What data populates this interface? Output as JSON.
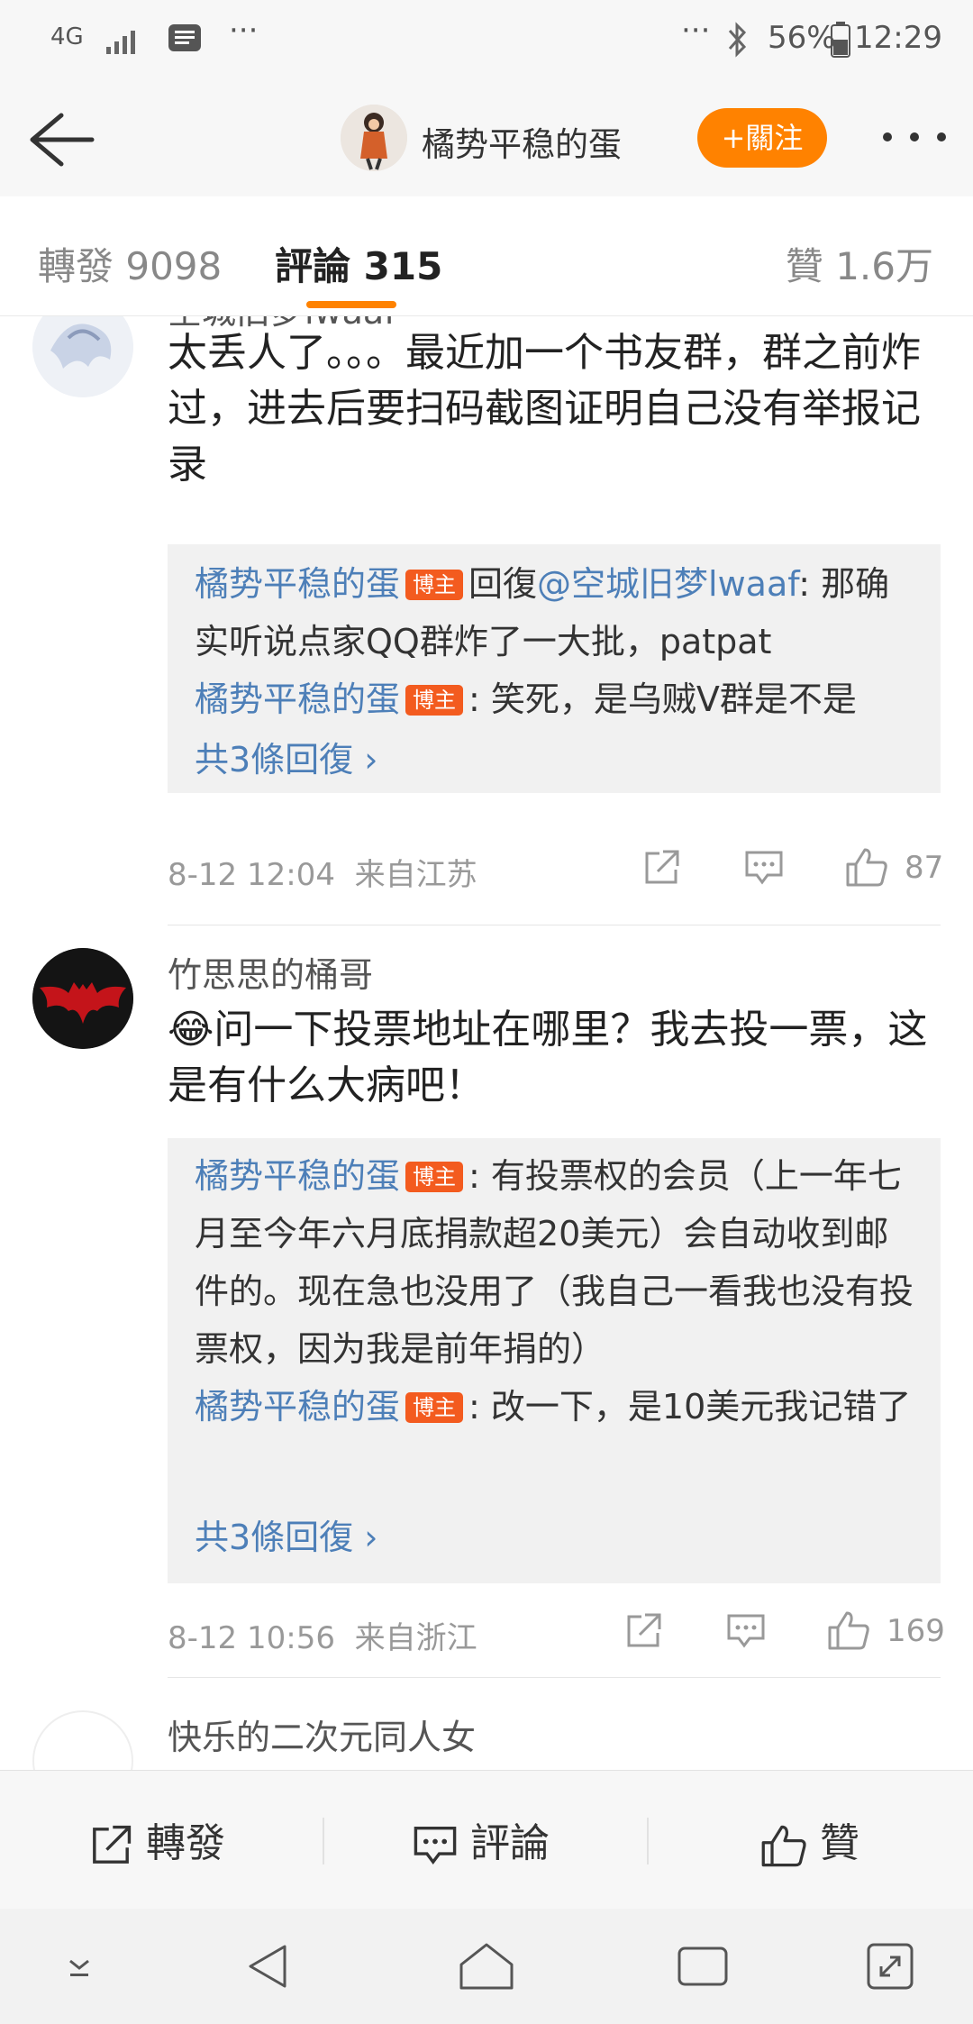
{
  "status_bar": {
    "network": "4G",
    "dots_left": "···",
    "dots_right": "···",
    "battery": "56%",
    "time": "12:29"
  },
  "header": {
    "title": "橘势平稳的蛋",
    "follow_label": "+關注"
  },
  "tabs": {
    "repost": "轉發 9098",
    "comments": "評論 315",
    "likes": "贊 1.6万"
  },
  "comments": [
    {
      "user": "空城旧梦lwaaf",
      "text": "太丢人了。。。最近加一个书友群，群之前炸过，进去后要扫码截图证明自己没有举报记录",
      "replies": [
        {
          "name": "橘势平稳的蛋",
          "badge": "博主",
          "prefix": "回復",
          "mention": "@空城旧梦lwaaf",
          "text": ": 那确实听说点家QQ群炸了一大批，patpat"
        },
        {
          "name": "橘势平稳的蛋",
          "badge": "博主",
          "text": ":  笑死，是乌贼V群是不是"
        }
      ],
      "more_replies": "共3條回復 ›",
      "time": "8-12 12:04",
      "location": "来自江苏",
      "likes": "87"
    },
    {
      "user": "竹思思的桶哥",
      "emoji": "😂",
      "text": "问一下投票地址在哪里？我去投一票，这是有什么大病吧！",
      "replies": [
        {
          "name": "橘势平稳的蛋",
          "badge": "博主",
          "text": ": 有投票权的会员（上一年七月至今年六月底捐款超20美元）会自动收到邮件的。现在急也没用了（我自己一看我也没有投票权，因为我是前年捐的）"
        },
        {
          "name": "橘势平稳的蛋",
          "badge": "博主",
          "text": ": 改一下，是10美元我记错了"
        }
      ],
      "more_replies": "共3條回復 ›",
      "time": "8-12 10:56",
      "location": "来自浙江",
      "likes": "169"
    },
    {
      "user": "快乐的二次元同人女"
    }
  ],
  "action_bar": {
    "repost": "轉發",
    "comment": "評論",
    "like": "贊"
  },
  "colors": {
    "accent": "#ff8200",
    "link": "#4d7fb8",
    "badge": "#f35b1f"
  }
}
